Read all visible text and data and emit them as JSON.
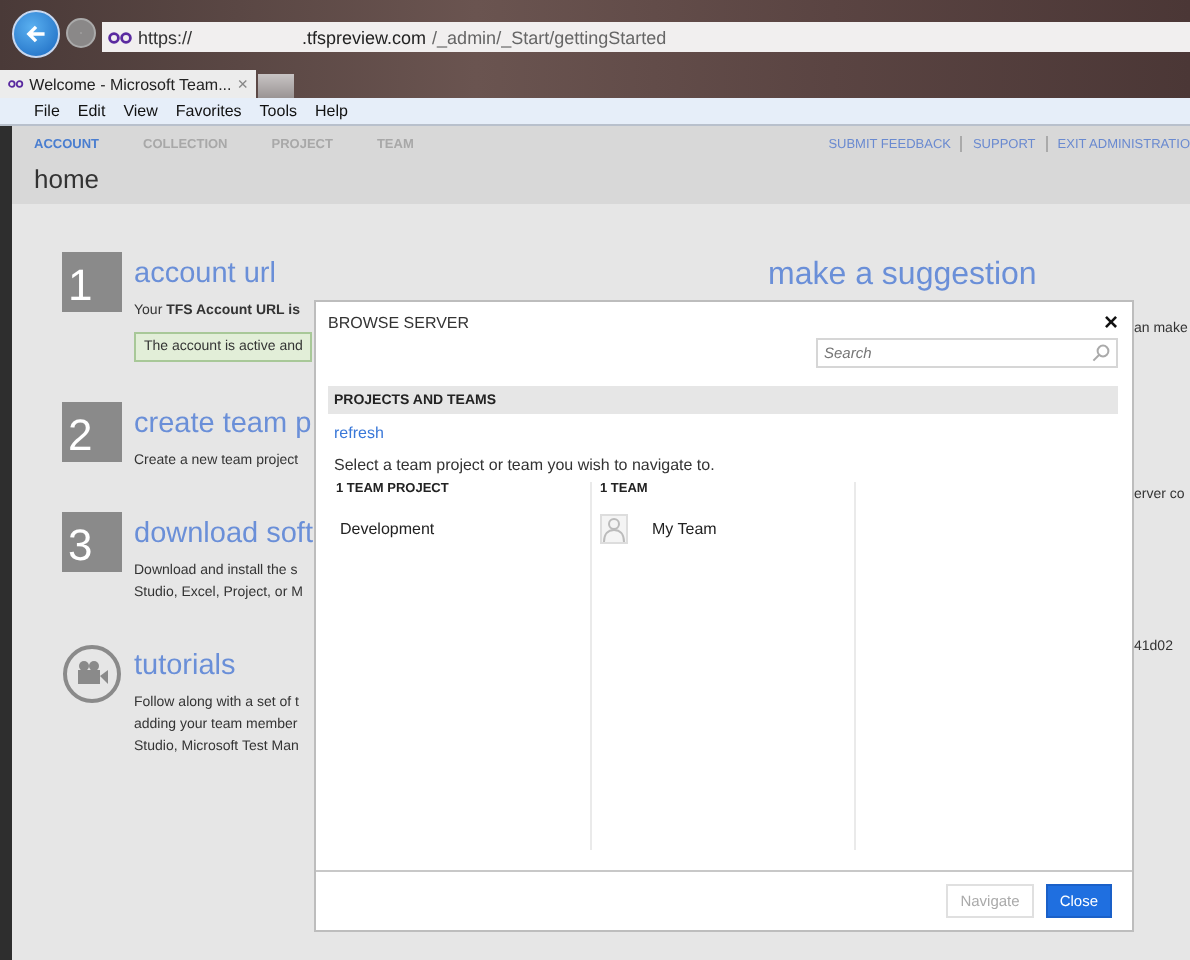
{
  "browser": {
    "url_scheme": "https://",
    "url_host": ".tfspreview.com",
    "url_path": "/_admin/_Start/gettingStarted",
    "tab_title": "Welcome - Microsoft Team...",
    "tab_close": "×"
  },
  "menu": [
    "File",
    "Edit",
    "View",
    "Favorites",
    "Tools",
    "Help"
  ],
  "nav": {
    "tabs": [
      {
        "label": "ACCOUNT",
        "selected": true
      },
      {
        "label": "COLLECTION",
        "selected": false
      },
      {
        "label": "PROJECT",
        "selected": false
      },
      {
        "label": "TEAM",
        "selected": false
      }
    ],
    "links": [
      "SUBMIT FEEDBACK",
      "SUPPORT",
      "EXIT ADMINISTRATIO"
    ],
    "page_title": "home"
  },
  "sections": [
    {
      "kind": "number",
      "number": "1",
      "title": "account url",
      "description": [
        "Your **TFS Account URL is**"
      ],
      "notice": "The account is active and",
      "aside": "an make"
    },
    {
      "kind": "number",
      "number": "2",
      "title": "create team p",
      "description": [
        "Create a new team project"
      ],
      "aside": "erver co"
    },
    {
      "kind": "number",
      "number": "3",
      "title": "download soft",
      "description": [
        "Download and install the s",
        "Studio, Excel, Project, or M"
      ],
      "aside": "41d02"
    },
    {
      "kind": "video",
      "title": "tutorials",
      "description": [
        "Follow along with a set of t",
        "adding your team member",
        "Studio, Microsoft Test Man"
      ]
    }
  ],
  "suggestion": {
    "title": "make a suggestion"
  },
  "dialog": {
    "title": "BROWSE SERVER",
    "close": "×",
    "search": {
      "placeholder": "Search"
    },
    "section_title": "PROJECTS AND TEAMS",
    "refresh": "refresh",
    "instruction": "Select a team project or team you wish to navigate to.",
    "columns": [
      {
        "heading": "1 TEAM PROJECT",
        "items": [
          {
            "label": "Development",
            "kind": "project"
          }
        ]
      },
      {
        "heading": "1 TEAM",
        "items": [
          {
            "label": "My Team",
            "kind": "team"
          }
        ]
      }
    ],
    "buttons": [
      {
        "label": "Navigate",
        "kind": "secondary",
        "disabled": true
      },
      {
        "label": "Close",
        "kind": "primary",
        "disabled": false
      }
    ]
  }
}
